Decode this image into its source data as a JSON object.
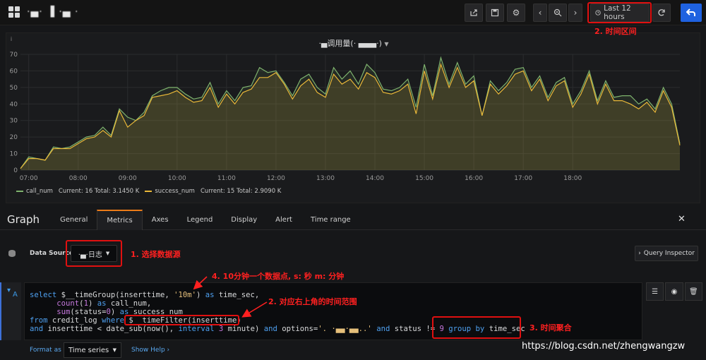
{
  "navbar": {
    "dashboard_title": "·▄· ▐ ·▄ ·",
    "time_range_label": "Last 12 hours",
    "icons": [
      "share-icon",
      "save-icon",
      "settings-icon",
      "zoom-back-icon",
      "zoom-out-icon",
      "zoom-forward-icon",
      "clock-icon",
      "refresh-icon",
      "back-arrow-icon"
    ]
  },
  "panel": {
    "title": "·▄调用量(· ▄▄▄·)",
    "info_icon": "i"
  },
  "chart_data": {
    "type": "area",
    "ylim": [
      0,
      70
    ],
    "yticks": [
      "0",
      "10",
      "20",
      "30",
      "40",
      "50",
      "60",
      "70"
    ],
    "xticks": [
      "07:00",
      "08:00",
      "09:00",
      "10:00",
      "11:00",
      "12:00",
      "13:00",
      "14:00",
      "15:00",
      "16:00",
      "17:00",
      "18:00"
    ],
    "x_start": "06:50",
    "x_step_minutes": 10,
    "series": [
      {
        "name": "call_num",
        "color": "#7eb26d",
        "values": [
          1,
          8,
          7,
          6,
          14,
          13,
          14,
          17,
          20,
          21,
          26,
          21,
          37,
          32,
          30,
          35,
          45,
          48,
          50,
          50,
          46,
          43,
          44,
          53,
          40,
          48,
          42,
          50,
          51,
          62,
          59,
          60,
          53,
          45,
          55,
          58,
          50,
          46,
          62,
          55,
          60,
          52,
          64,
          59,
          49,
          48,
          50,
          55,
          38,
          64,
          45,
          68,
          52,
          65,
          52,
          57,
          33,
          54,
          48,
          53,
          61,
          62,
          50,
          57,
          44,
          53,
          56,
          40,
          48,
          60,
          42,
          54,
          44,
          45,
          45,
          40,
          43,
          37,
          50,
          40,
          16
        ]
      },
      {
        "name": "success_num",
        "color": "#eab839",
        "values": [
          1,
          7,
          7,
          6,
          13,
          13,
          13,
          16,
          19,
          20,
          24,
          20,
          36,
          26,
          30,
          33,
          44,
          45,
          46,
          48,
          44,
          41,
          42,
          50,
          38,
          46,
          40,
          47,
          49,
          56,
          56,
          59,
          52,
          43,
          51,
          55,
          47,
          44,
          58,
          52,
          55,
          49,
          59,
          56,
          47,
          46,
          48,
          52,
          34,
          60,
          43,
          64,
          50,
          62,
          50,
          54,
          33,
          52,
          46,
          51,
          58,
          60,
          48,
          55,
          42,
          51,
          54,
          38,
          46,
          58,
          40,
          52,
          42,
          42,
          40,
          37,
          41,
          35,
          48,
          38,
          15
        ]
      }
    ],
    "legend": [
      {
        "name": "call_num",
        "text": "Current: 16  Total: 3.1450 K"
      },
      {
        "name": "success_num",
        "text": "Current: 15  Total: 2.9090 K"
      }
    ],
    "legend_position": "bottom-left",
    "grid": true
  },
  "editor": {
    "title": "Graph",
    "tabs": [
      "General",
      "Metrics",
      "Axes",
      "Legend",
      "Display",
      "Alert",
      "Time range"
    ],
    "active_tab": "Metrics",
    "close_label": "✕",
    "datasource_label": "Data Source",
    "datasource_value": "·▄·日志",
    "query_inspector_label": "Query Inspector",
    "query_ref": "A",
    "format_as_label": "Format as",
    "format_value": "Time series",
    "show_help_label": "Show Help"
  },
  "annotations": {
    "a1": "1. 选择数据源",
    "a2": "2. 对应右上角的时间范围",
    "a2b": "2. 时间区间",
    "a3": "3. 时间聚合",
    "a4": "4. 10分钟一个数据点, s: 秒 m: 分钟",
    "accent": "#e01010"
  },
  "watermark": "https://blog.csdn.net/zhengwangzw"
}
